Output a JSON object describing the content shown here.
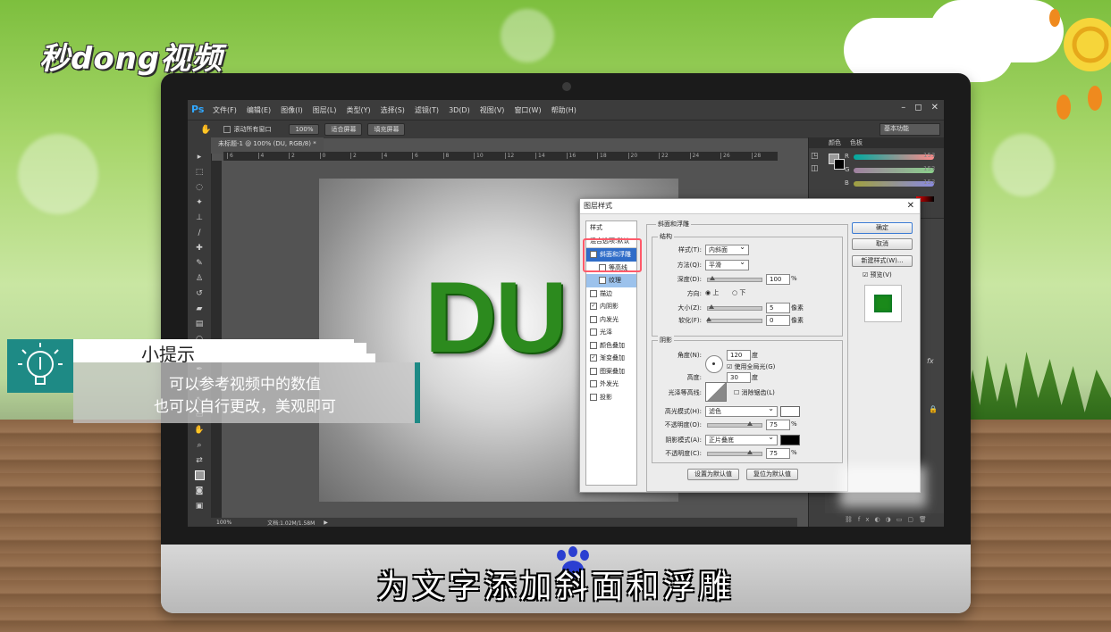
{
  "brand": {
    "logo_text": "秒dong视频"
  },
  "photoshop": {
    "logo": "Ps",
    "menus": [
      "文件(F)",
      "编辑(E)",
      "图像(I)",
      "图层(L)",
      "类型(Y)",
      "选择(S)",
      "滤镜(T)",
      "3D(D)",
      "视图(V)",
      "窗口(W)",
      "帮助(H)"
    ],
    "window_buttons": [
      "–",
      "◻",
      "✕"
    ],
    "options_bar": {
      "scroll_all_windows": "滚动所有窗口",
      "zoom_100": "100%",
      "fit_screen": "适合屏幕",
      "fill_screen": "填充屏幕",
      "workspace": "基本功能"
    },
    "document_tab": "未标题-1 @ 100% (DU, RGB/8) *",
    "ruler_ticks": [
      "6",
      "4",
      "2",
      "0",
      "2",
      "4",
      "6",
      "8",
      "10",
      "12",
      "14",
      "16",
      "18",
      "20",
      "22",
      "24",
      "26",
      "28"
    ],
    "canvas_text": "DU",
    "status": {
      "zoom": "100%",
      "doc": "文档:1.02M/1.58M"
    },
    "right_panel": {
      "tabs": [
        "颜色",
        "色板"
      ],
      "channels": [
        "R",
        "G",
        "B"
      ],
      "values": [
        "153",
        "153",
        "153"
      ]
    }
  },
  "dialog": {
    "title": "图层样式",
    "close": "✕",
    "styles_header": "样式",
    "blend_options": "混合选项:默认",
    "style_items": [
      {
        "label": "斜面和浮雕",
        "checked": true,
        "state": "selected"
      },
      {
        "label": "等高线",
        "checked": false,
        "state": "sub"
      },
      {
        "label": "纹理",
        "checked": false,
        "state": "sub-selected"
      },
      {
        "label": "描边",
        "checked": false
      },
      {
        "label": "内阴影",
        "checked": true
      },
      {
        "label": "内发光",
        "checked": false
      },
      {
        "label": "光泽",
        "checked": false
      },
      {
        "label": "颜色叠加",
        "checked": false
      },
      {
        "label": "渐变叠加",
        "checked": true
      },
      {
        "label": "图案叠加",
        "checked": false
      },
      {
        "label": "外发光",
        "checked": false
      },
      {
        "label": "投影",
        "checked": false
      }
    ],
    "bevel": {
      "section": "斜面和浮雕",
      "structure": "结构",
      "style_label": "样式(T):",
      "style_value": "内斜面",
      "technique_label": "方法(Q):",
      "technique_value": "平滑",
      "depth_label": "深度(D):",
      "depth_value": "100",
      "depth_unit": "%",
      "direction_label": "方向:",
      "dir_up": "上",
      "dir_down": "下",
      "size_label": "大小(Z):",
      "size_value": "5",
      "size_unit": "像素",
      "soften_label": "软化(F):",
      "soften_value": "0",
      "soften_unit": "像素"
    },
    "shading": {
      "section": "阴影",
      "angle_label": "角度(N):",
      "angle_value": "120",
      "angle_unit": "度",
      "global_light": "使用全局光(G)",
      "altitude_label": "高度:",
      "altitude_value": "30",
      "altitude_unit": "度",
      "gloss_label": "光泽等高线:",
      "anti_alias": "消除锯齿(L)",
      "highlight_label": "高光模式(H):",
      "highlight_value": "滤色",
      "hl_opacity_label": "不透明度(O):",
      "hl_opacity_value": "75",
      "hl_opacity_unit": "%",
      "shadow_label": "阴影模式(A):",
      "shadow_value": "正片叠底",
      "sh_opacity_label": "不透明度(C):",
      "sh_opacity_value": "75",
      "sh_opacity_unit": "%",
      "highlight_color": "#ffffff",
      "shadow_color": "#000000"
    },
    "buttons": {
      "ok": "确定",
      "cancel": "取消",
      "new_style": "新建样式(W)...",
      "preview": "预览(V)",
      "make_default": "设置为默认值",
      "reset_default": "复位为默认值"
    }
  },
  "tip": {
    "title": "小提示",
    "line1": "可以参考视频中的数值",
    "line2": "也可以自行更改，美观即可"
  },
  "subtitle": "为文字添加斜面和浮雕",
  "colors": {
    "accent_teal": "#1e8a85",
    "ps_blue": "#31a8ff",
    "selection_blue": "#2f6cc8",
    "highlight_red": "#ff5a6a",
    "du_green": "#2c8a1e"
  }
}
